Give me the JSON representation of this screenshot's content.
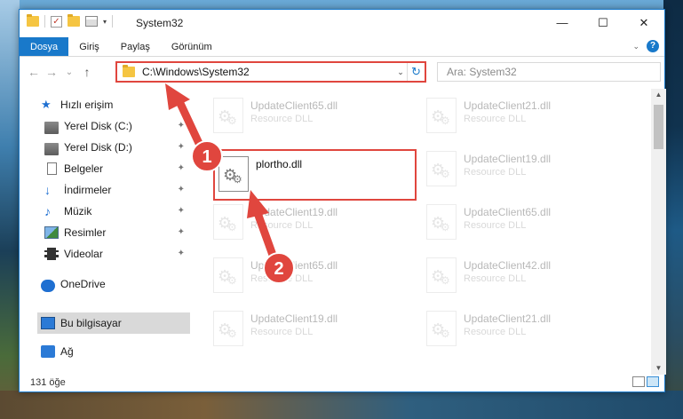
{
  "window": {
    "title": "System32",
    "controls": {
      "minimize": "—",
      "maximize": "☐",
      "close": "✕"
    }
  },
  "ribbon": {
    "tabs": [
      "Dosya",
      "Giriş",
      "Paylaş",
      "Görünüm"
    ],
    "active_tab": "Dosya",
    "help": "?"
  },
  "navigation": {
    "back": "←",
    "forward": "→",
    "recent": "⌄",
    "up": "↑",
    "address": "C:\\Windows\\System32",
    "refresh": "↻",
    "search_placeholder": "Ara: System32"
  },
  "sidebar": {
    "items": [
      {
        "label": "Hızlı erişim",
        "icon": "star-icon",
        "pinned": false
      },
      {
        "label": "Yerel Disk (C:)",
        "icon": "disk-icon",
        "pinned": true
      },
      {
        "label": "Yerel Disk (D:)",
        "icon": "disk-icon",
        "pinned": true
      },
      {
        "label": "Belgeler",
        "icon": "document-icon",
        "pinned": true
      },
      {
        "label": "İndirmeler",
        "icon": "download-icon",
        "pinned": true
      },
      {
        "label": "Müzik",
        "icon": "music-icon",
        "pinned": true
      },
      {
        "label": "Resimler",
        "icon": "picture-icon",
        "pinned": true
      },
      {
        "label": "Videolar",
        "icon": "video-icon",
        "pinned": true
      },
      {
        "label": "OneDrive",
        "icon": "cloud-icon",
        "pinned": false
      },
      {
        "label": "Bu bilgisayar",
        "icon": "computer-icon",
        "pinned": false,
        "selected": true
      },
      {
        "label": "Ağ",
        "icon": "network-icon",
        "pinned": false
      }
    ]
  },
  "files": {
    "items": [
      {
        "name": "UpdateClient65.dll",
        "type": "Resource DLL",
        "faded": true
      },
      {
        "name": "UpdateClient21.dll",
        "type": "Resource DLL",
        "faded": true
      },
      {
        "name": "plortho.dll",
        "type": "",
        "faded": false,
        "highlighted": true
      },
      {
        "name": "UpdateClient19.dll",
        "type": "Resource DLL",
        "faded": true
      },
      {
        "name": "UpdateClient19.dll",
        "type": "Resource DLL",
        "faded": true
      },
      {
        "name": "UpdateClient65.dll",
        "type": "Resource DLL",
        "faded": true
      },
      {
        "name": "UpdateClient65.dll",
        "type": "Resource DLL",
        "faded": true
      },
      {
        "name": "UpdateClient42.dll",
        "type": "Resource DLL",
        "faded": true
      },
      {
        "name": "UpdateClient19.dll",
        "type": "Resource DLL",
        "faded": true
      },
      {
        "name": "UpdateClient21.dll",
        "type": "Resource DLL",
        "faded": true
      }
    ]
  },
  "status": {
    "count": "131 öğe"
  },
  "annotations": {
    "step1": "1",
    "step2": "2",
    "color": "#e0463e"
  }
}
